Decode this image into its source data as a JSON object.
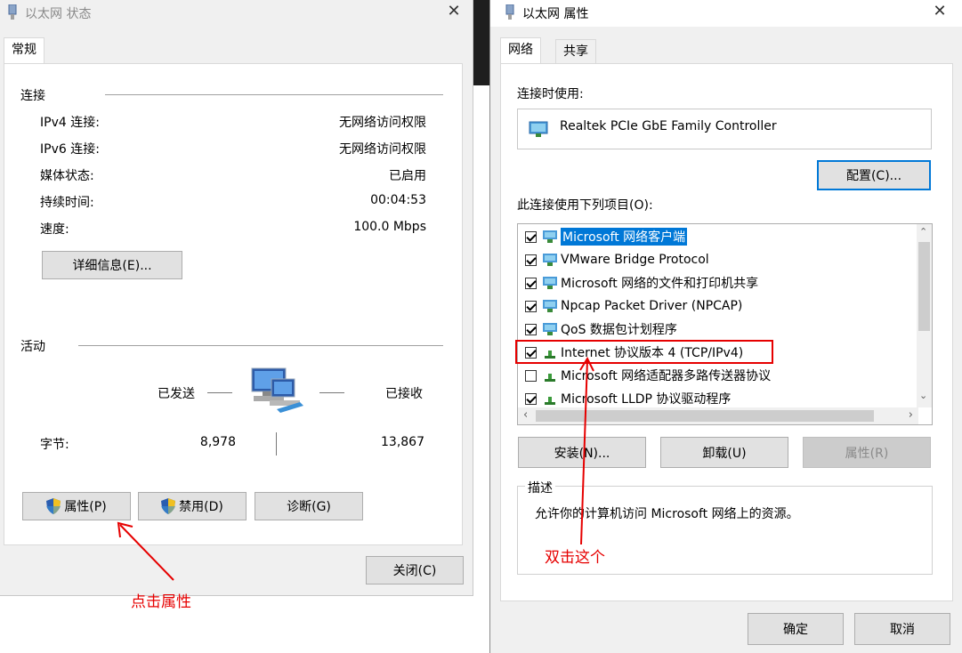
{
  "status_dialog": {
    "title": "以太网 状态",
    "tab": "常规",
    "connection": {
      "section": "连接",
      "rows": [
        {
          "label": "IPv4 连接:",
          "value": "无网络访问权限"
        },
        {
          "label": "IPv6 连接:",
          "value": "无网络访问权限"
        },
        {
          "label": "媒体状态:",
          "value": "已启用"
        },
        {
          "label": "持续时间:",
          "value": "00:04:53"
        },
        {
          "label": "速度:",
          "value": "100.0 Mbps"
        }
      ],
      "details_button": "详细信息(E)..."
    },
    "activity": {
      "section": "活动",
      "sent": "已发送",
      "received": "已接收",
      "bytes_label": "字节:",
      "bytes_sent": "8,978",
      "bytes_received": "13,867"
    },
    "buttons": {
      "properties": "属性(P)",
      "disable": "禁用(D)",
      "diagnose": "诊断(G)",
      "close": "关闭(C)"
    }
  },
  "properties_dialog": {
    "title": "以太网 属性",
    "tabs": [
      "网络",
      "共享"
    ],
    "connect_using_label": "连接时使用:",
    "adapter_name": "Realtek PCIe GbE Family Controller",
    "configure_button": "配置(C)...",
    "items_label": "此连接使用下列项目(O):",
    "items": [
      {
        "label": "Microsoft 网络客户端",
        "checked": true,
        "selected": true
      },
      {
        "label": "VMware Bridge Protocol",
        "checked": true
      },
      {
        "label": "Microsoft 网络的文件和打印机共享",
        "checked": true
      },
      {
        "label": "Npcap Packet Driver (NPCAP)",
        "checked": true
      },
      {
        "label": "QoS 数据包计划程序",
        "checked": true
      },
      {
        "label": "Internet 协议版本 4 (TCP/IPv4)",
        "checked": true
      },
      {
        "label": "Microsoft 网络适配器多路传送器协议",
        "checked": false
      },
      {
        "label": "Microsoft LLDP 协议驱动程序",
        "checked": true
      }
    ],
    "install_button": "安装(N)...",
    "uninstall_button": "卸载(U)",
    "properties_button": "属性(R)",
    "description_label": "描述",
    "description_text": "允许你的计算机访问 Microsoft 网络上的资源。",
    "ok_button": "确定",
    "cancel_button": "取消"
  },
  "annotations": {
    "click_properties": "点击属性",
    "double_click_this": "双击这个",
    "color": "#e60000"
  }
}
